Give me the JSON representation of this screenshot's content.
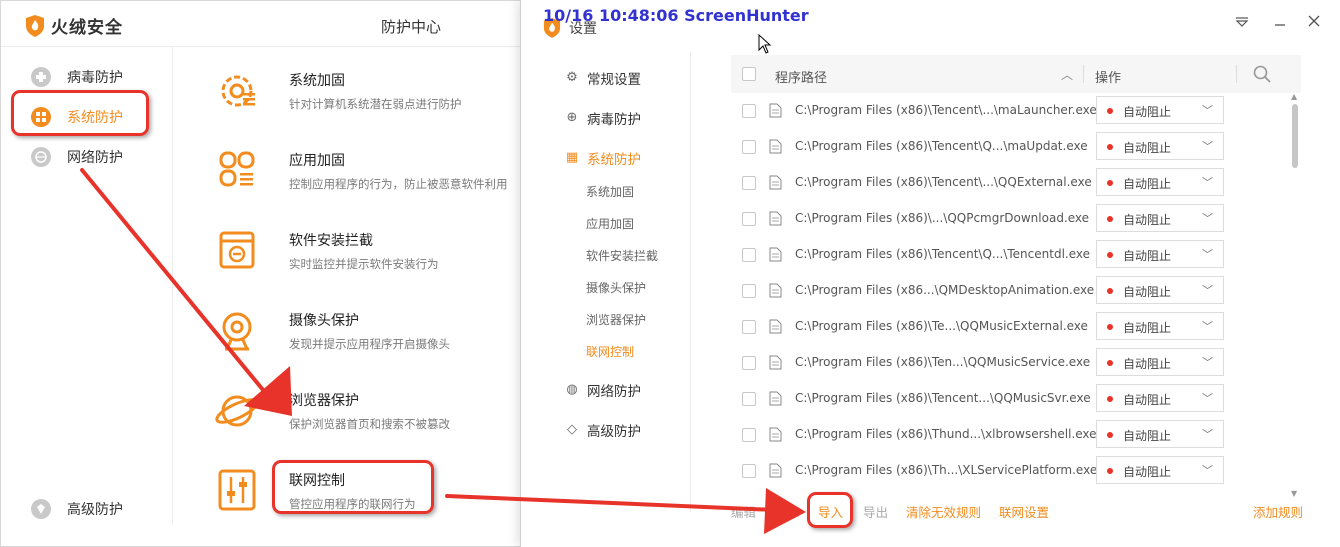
{
  "left_window": {
    "brand": "火绒安全",
    "title": "防护中心",
    "nav": [
      {
        "label": "病毒防护"
      },
      {
        "label": "系统防护"
      },
      {
        "label": "网络防护"
      },
      {
        "label": "高级防护"
      }
    ],
    "features": [
      {
        "name": "系统加固",
        "desc": "针对计算机系统潜在弱点进行防护"
      },
      {
        "name": "应用加固",
        "desc": "控制应用程序的行为，防止被恶意软件利用"
      },
      {
        "name": "软件安装拦截",
        "desc": "实时监控并提示软件安装行为"
      },
      {
        "name": "摄像头保护",
        "desc": "发现并提示应用程序开启摄像头"
      },
      {
        "name": "浏览器保护",
        "desc": "保护浏览器首页和搜索不被篡改"
      },
      {
        "name": "联网控制",
        "desc": "管控应用程序的联网行为"
      }
    ]
  },
  "right_window": {
    "title": "设置",
    "nav": {
      "general": "常规设置",
      "virus": "病毒防护",
      "system": "系统防护",
      "sub": [
        "系统加固",
        "应用加固",
        "软件安装拦截",
        "摄像头保护",
        "浏览器保护",
        "联网控制"
      ],
      "network": "网络防护",
      "advanced": "高级防护"
    },
    "table": {
      "col_path": "程序路径",
      "col_action": "操作",
      "rows": [
        {
          "path": "C:\\Program Files (x86)\\Tencent\\...\\maLauncher.exe",
          "action": "自动阻止"
        },
        {
          "path": "C:\\Program Files (x86)\\Tencent\\Q...\\maUpdat.exe",
          "action": "自动阻止"
        },
        {
          "path": "C:\\Program Files (x86)\\Tencent\\...\\QQExternal.exe",
          "action": "自动阻止"
        },
        {
          "path": "C:\\Program Files (x86)\\...\\QQPcmgrDownload.exe",
          "action": "自动阻止"
        },
        {
          "path": "C:\\Program Files (x86)\\Tencent\\Q...\\Tencentdl.exe",
          "action": "自动阻止"
        },
        {
          "path": "C:\\Program Files (x86...\\QMDesktopAnimation.exe",
          "action": "自动阻止"
        },
        {
          "path": "C:\\Program Files (x86)\\Te...\\QQMusicExternal.exe",
          "action": "自动阻止"
        },
        {
          "path": "C:\\Program Files (x86)\\Ten...\\QQMusicService.exe",
          "action": "自动阻止"
        },
        {
          "path": "C:\\Program Files (x86)\\Tencent...\\QQMusicSvr.exe",
          "action": "自动阻止"
        },
        {
          "path": "C:\\Program Files (x86)\\Thund...\\xlbrowsershell.exe",
          "action": "自动阻止"
        },
        {
          "path": "C:\\Program Files (x86)\\Th...\\XLServicePlatform.exe",
          "action": "自动阻止"
        }
      ]
    },
    "footer": {
      "edit": "编辑",
      "delete": "删除",
      "import": "导入",
      "export": "导出",
      "clear_invalid": "清除无效规则",
      "network_settings": "联网设置",
      "add_rule": "添加规则"
    }
  },
  "watermark": "10/16  10:48:06  ScreenHunter",
  "colors": {
    "accent": "#f28c1f",
    "annotation_red": "#e8332a",
    "watermark_blue": "#3232d2"
  }
}
